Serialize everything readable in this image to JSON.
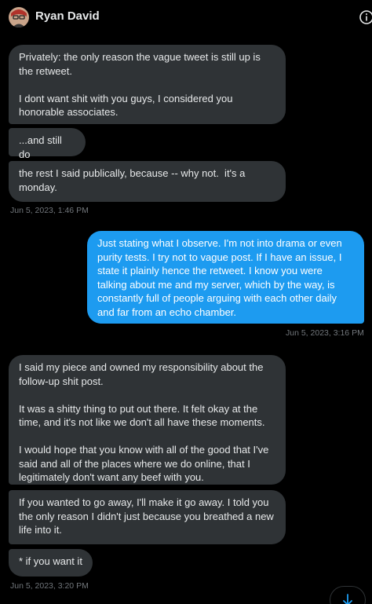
{
  "header": {
    "name": "Ryan David"
  },
  "messages": [
    {
      "text": "Privately: the only reason the vague tweet is still up is the retweet.\n\nI dont want shit with you guys, I considered you honorable associates."
    },
    {
      "text": "...and still do"
    },
    {
      "text": "the rest I said publically, because -- why not.  it's a monday."
    },
    {
      "timestamp": "Jun 5, 2023, 1:46 PM"
    },
    {
      "text": "Just stating what I observe. I'm not into drama or even purity tests. I try not to vague post. If I have an issue, I state it plainly hence the retweet. I know you were talking about me and my server, which by the way, is constantly full of people arguing with each other daily and far from an echo chamber."
    },
    {
      "timestamp": "Jun 5, 2023, 3:16 PM"
    },
    {
      "text": "I said my piece and owned my responsibility about the follow-up shit post.\n\nIt was a shitty thing to put out there. It felt okay at the time, and it's not like we don't all have these moments.\n\nI would hope that you know with all of the good that I've said and all of the places where we do online, that I legitimately don't want any beef with you."
    },
    {
      "text": "If you wanted to go away, I'll make it go away. I told you the only reason I didn't just because you breathed a new life into it."
    },
    {
      "text": "* if you want it"
    },
    {
      "timestamp": "Jun 5, 2023, 3:20 PM"
    }
  ],
  "colors": {
    "received_bubble": "#2f3336",
    "sent_bubble": "#1d9bf0",
    "timestamp": "#71767b",
    "background": "#000000"
  },
  "icons": {
    "info": "info-icon",
    "scroll": "arrow-down-icon"
  }
}
